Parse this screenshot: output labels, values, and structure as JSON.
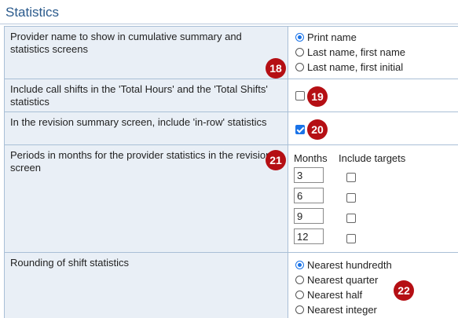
{
  "section": {
    "title": "Statistics"
  },
  "rows": {
    "provider_name": {
      "label": "Provider name to show in cumulative summary and statistics screens",
      "options": [
        "Print name",
        "Last name, first name",
        "Last name, first initial"
      ],
      "selected_index": 0,
      "badge": "18"
    },
    "call_shifts": {
      "label": "Include call shifts in the 'Total Hours' and the 'Total Shifts' statistics",
      "checked": false,
      "badge": "19"
    },
    "in_row": {
      "label": "In the revision summary screen, include 'in-row' statistics",
      "checked": true,
      "badge": "20"
    },
    "periods": {
      "label": "Periods in months for the provider statistics in the revision screen",
      "badge": "21",
      "col_months": "Months",
      "col_targets": "Include targets",
      "months": [
        "3",
        "6",
        "9",
        "12"
      ],
      "targets": [
        false,
        false,
        false,
        false
      ]
    },
    "rounding": {
      "label": "Rounding of shift statistics",
      "options": [
        "Nearest hundredth",
        "Nearest quarter",
        "Nearest half",
        "Nearest integer"
      ],
      "selected_index": 0,
      "badge": "22"
    }
  },
  "colors": {
    "accent": "#1a73e8",
    "badge": "#b50f14",
    "label_bg": "#e9eff6",
    "title": "#2a5a8c"
  }
}
